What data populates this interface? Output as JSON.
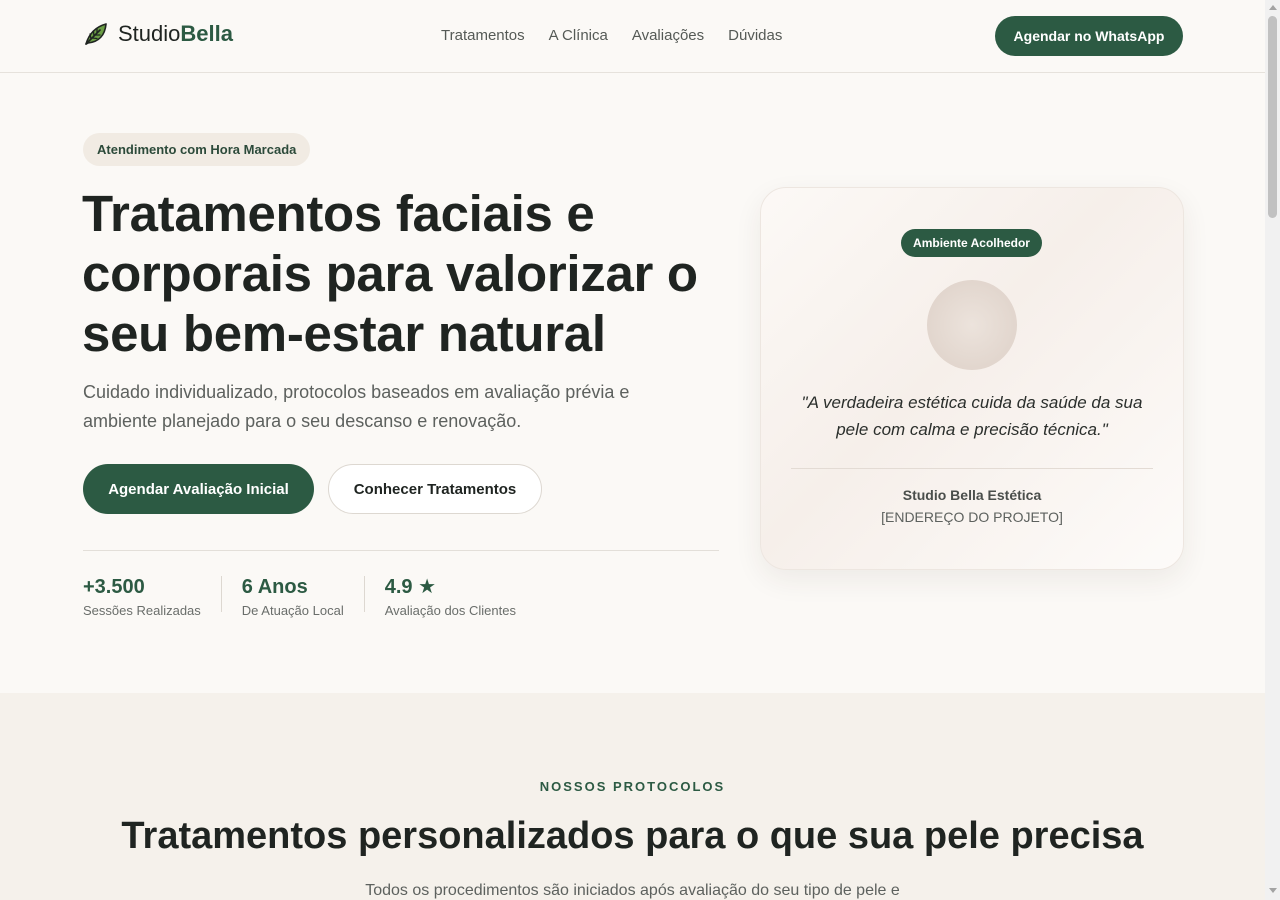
{
  "header": {
    "logo_regular": "Studio",
    "logo_bold": "Bella",
    "logo_icon": "leaf-icon",
    "nav": [
      "Tratamentos",
      "A Clínica",
      "Avaliações",
      "Dúvidas"
    ],
    "cta": "Agendar no WhatsApp"
  },
  "hero": {
    "badge": "Atendimento com Hora Marcada",
    "title_lines": [
      "Tratamentos faciais e",
      "corporais para valorizar o",
      "seu bem-estar natural"
    ],
    "subtitle_lines": [
      "Cuidado individualizado, protocolos baseados em avaliação prévia e",
      "ambiente planejado para o seu descanso e renovação."
    ],
    "primary_button": "Agendar Avaliação Inicial",
    "secondary_button": "Conhecer Tratamentos",
    "stats": [
      {
        "value": "+3.500",
        "label": "Sessões Realizadas"
      },
      {
        "value": "6 Anos",
        "label": "De Atuação Local"
      },
      {
        "value": "4.9 ★",
        "label": "Avaliação dos Clientes"
      }
    ]
  },
  "card": {
    "badge": "Ambiente Acolhedor",
    "quote_lines": [
      "\"A verdadeira estética cuida da saúde da sua",
      "pele com calma e precisão técnica.\""
    ],
    "name": "Studio Bella Estética",
    "address": "[ENDEREÇO DO PROJETO]"
  },
  "protocols": {
    "eyebrow": "NOSSOS PROTOCOLOS",
    "title": "Tratamentos personalizados para o que sua pele precisa",
    "subtitle": "Todos os procedimentos são iniciados após avaliação do seu tipo de pele e"
  },
  "colors": {
    "accent": "#2c5a43",
    "background": "#fbf9f6",
    "section_background": "#f5f1eb"
  }
}
